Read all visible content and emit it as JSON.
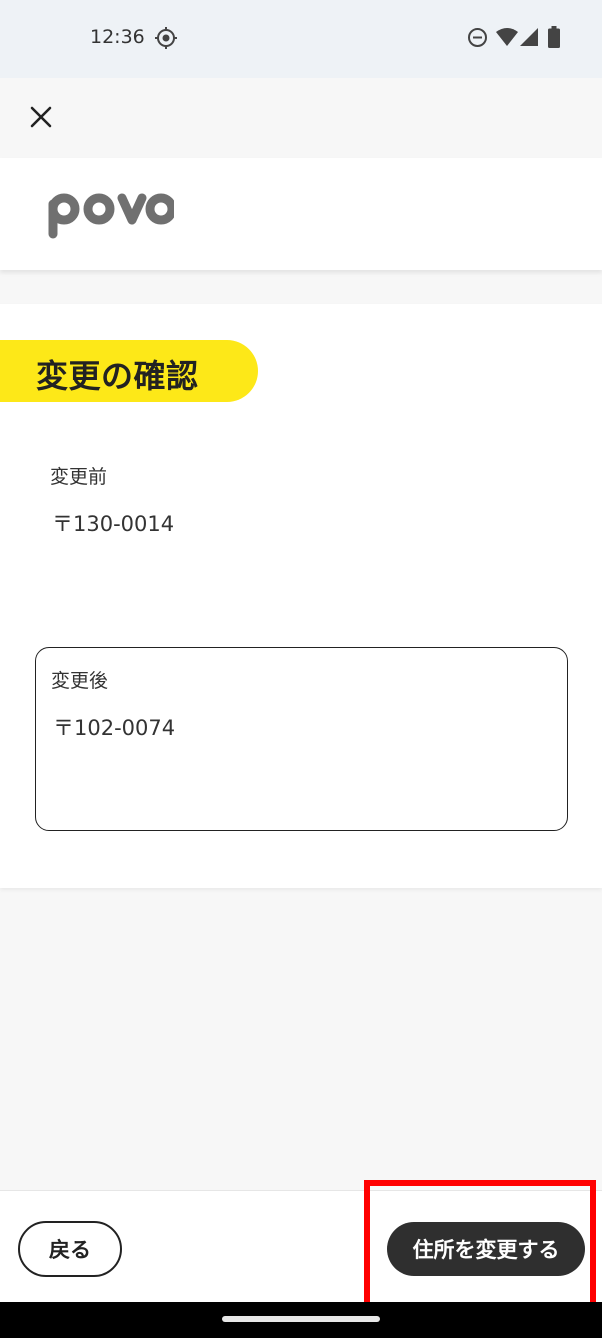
{
  "status_bar": {
    "time": "12:36",
    "icons": [
      "location-target-icon",
      "do-not-disturb-icon",
      "wifi-icon",
      "signal-icon",
      "battery-icon"
    ]
  },
  "header": {
    "close_icon": "close-icon",
    "logo_text": "povo"
  },
  "main": {
    "title": "変更の確認",
    "before": {
      "label": "変更前",
      "value": "〒130-0014"
    },
    "after": {
      "label": "変更後",
      "value": "〒102-0074"
    }
  },
  "actions": {
    "back_label": "戻る",
    "submit_label": "住所を変更する"
  },
  "colors": {
    "accent_yellow": "#fde818",
    "primary_button": "#2f2f2f",
    "highlight": "#ff0000"
  }
}
